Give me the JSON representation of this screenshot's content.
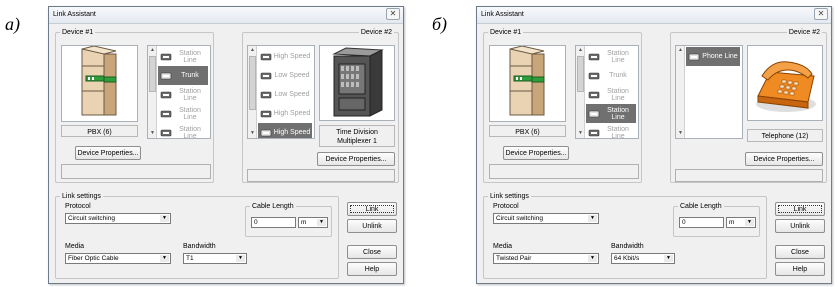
{
  "panels": [
    {
      "label": "а)",
      "title": "Link Assistant",
      "device1": {
        "legend": "Device #1",
        "name": "PBX (6)",
        "props_button": "Device Properties..."
      },
      "device2": {
        "legend": "Device #2",
        "name": "Time Division Multiplexer 1",
        "props_button": "Device Properties..."
      },
      "list1": [
        {
          "label": "Station Line",
          "selected": false,
          "icon": "station-line-icon"
        },
        {
          "label": "Trunk",
          "selected": true,
          "icon": "trunk-icon"
        },
        {
          "label": "Station Line",
          "selected": false,
          "icon": "station-line-icon"
        },
        {
          "label": "Station Line",
          "selected": false,
          "icon": "station-line-icon"
        },
        {
          "label": "Station Line",
          "selected": false,
          "icon": "station-line-icon"
        }
      ],
      "list2": [
        {
          "label": "High Speed",
          "selected": false,
          "icon": "port-icon"
        },
        {
          "label": "Low Speed",
          "selected": false,
          "icon": "port-icon"
        },
        {
          "label": "Low Speed",
          "selected": false,
          "icon": "port-icon"
        },
        {
          "label": "High Speed",
          "selected": false,
          "icon": "port-icon"
        },
        {
          "label": "High Speed",
          "selected": true,
          "icon": "port-icon"
        }
      ],
      "link_settings": {
        "legend": "Link settings",
        "protocol_label": "Protocol",
        "protocol": "Circuit switching",
        "media_label": "Media",
        "media": "Fiber Optic Cable",
        "bandwidth_label": "Bandwidth",
        "bandwidth": "T1",
        "cable_length_legend": "Cable Length",
        "cable_length": "0",
        "unit": "m"
      },
      "buttons": {
        "link": "Link",
        "unlink": "Unlink",
        "close": "Close",
        "help": "Help"
      }
    },
    {
      "label": "б)",
      "title": "Link Assistant",
      "device1": {
        "legend": "Device #1",
        "name": "PBX (6)",
        "props_button": "Device Properties..."
      },
      "device2": {
        "legend": "Device #2",
        "name": "Telephone (12)",
        "props_button": "Device Properties..."
      },
      "list1": [
        {
          "label": "Station Line",
          "selected": false,
          "icon": "station-line-icon"
        },
        {
          "label": "Trunk",
          "selected": false,
          "icon": "trunk-icon"
        },
        {
          "label": "Station Line",
          "selected": false,
          "icon": "station-line-icon"
        },
        {
          "label": "Station Line",
          "selected": true,
          "icon": "station-line-icon"
        },
        {
          "label": "Station Line",
          "selected": false,
          "icon": "station-line-icon"
        }
      ],
      "list2": [
        {
          "label": "Phone Line",
          "selected": true,
          "icon": "phone-line-icon"
        }
      ],
      "link_settings": {
        "legend": "Link settings",
        "protocol_label": "Protocol",
        "protocol": "Circuit switching",
        "media_label": "Media",
        "media": "Twisted Pair",
        "bandwidth_label": "Bandwidth",
        "bandwidth": "64 Kbit/s",
        "cable_length_legend": "Cable Length",
        "cable_length": "0",
        "unit": "m"
      },
      "buttons": {
        "link": "Link",
        "unlink": "Unlink",
        "close": "Close",
        "help": "Help"
      }
    }
  ]
}
